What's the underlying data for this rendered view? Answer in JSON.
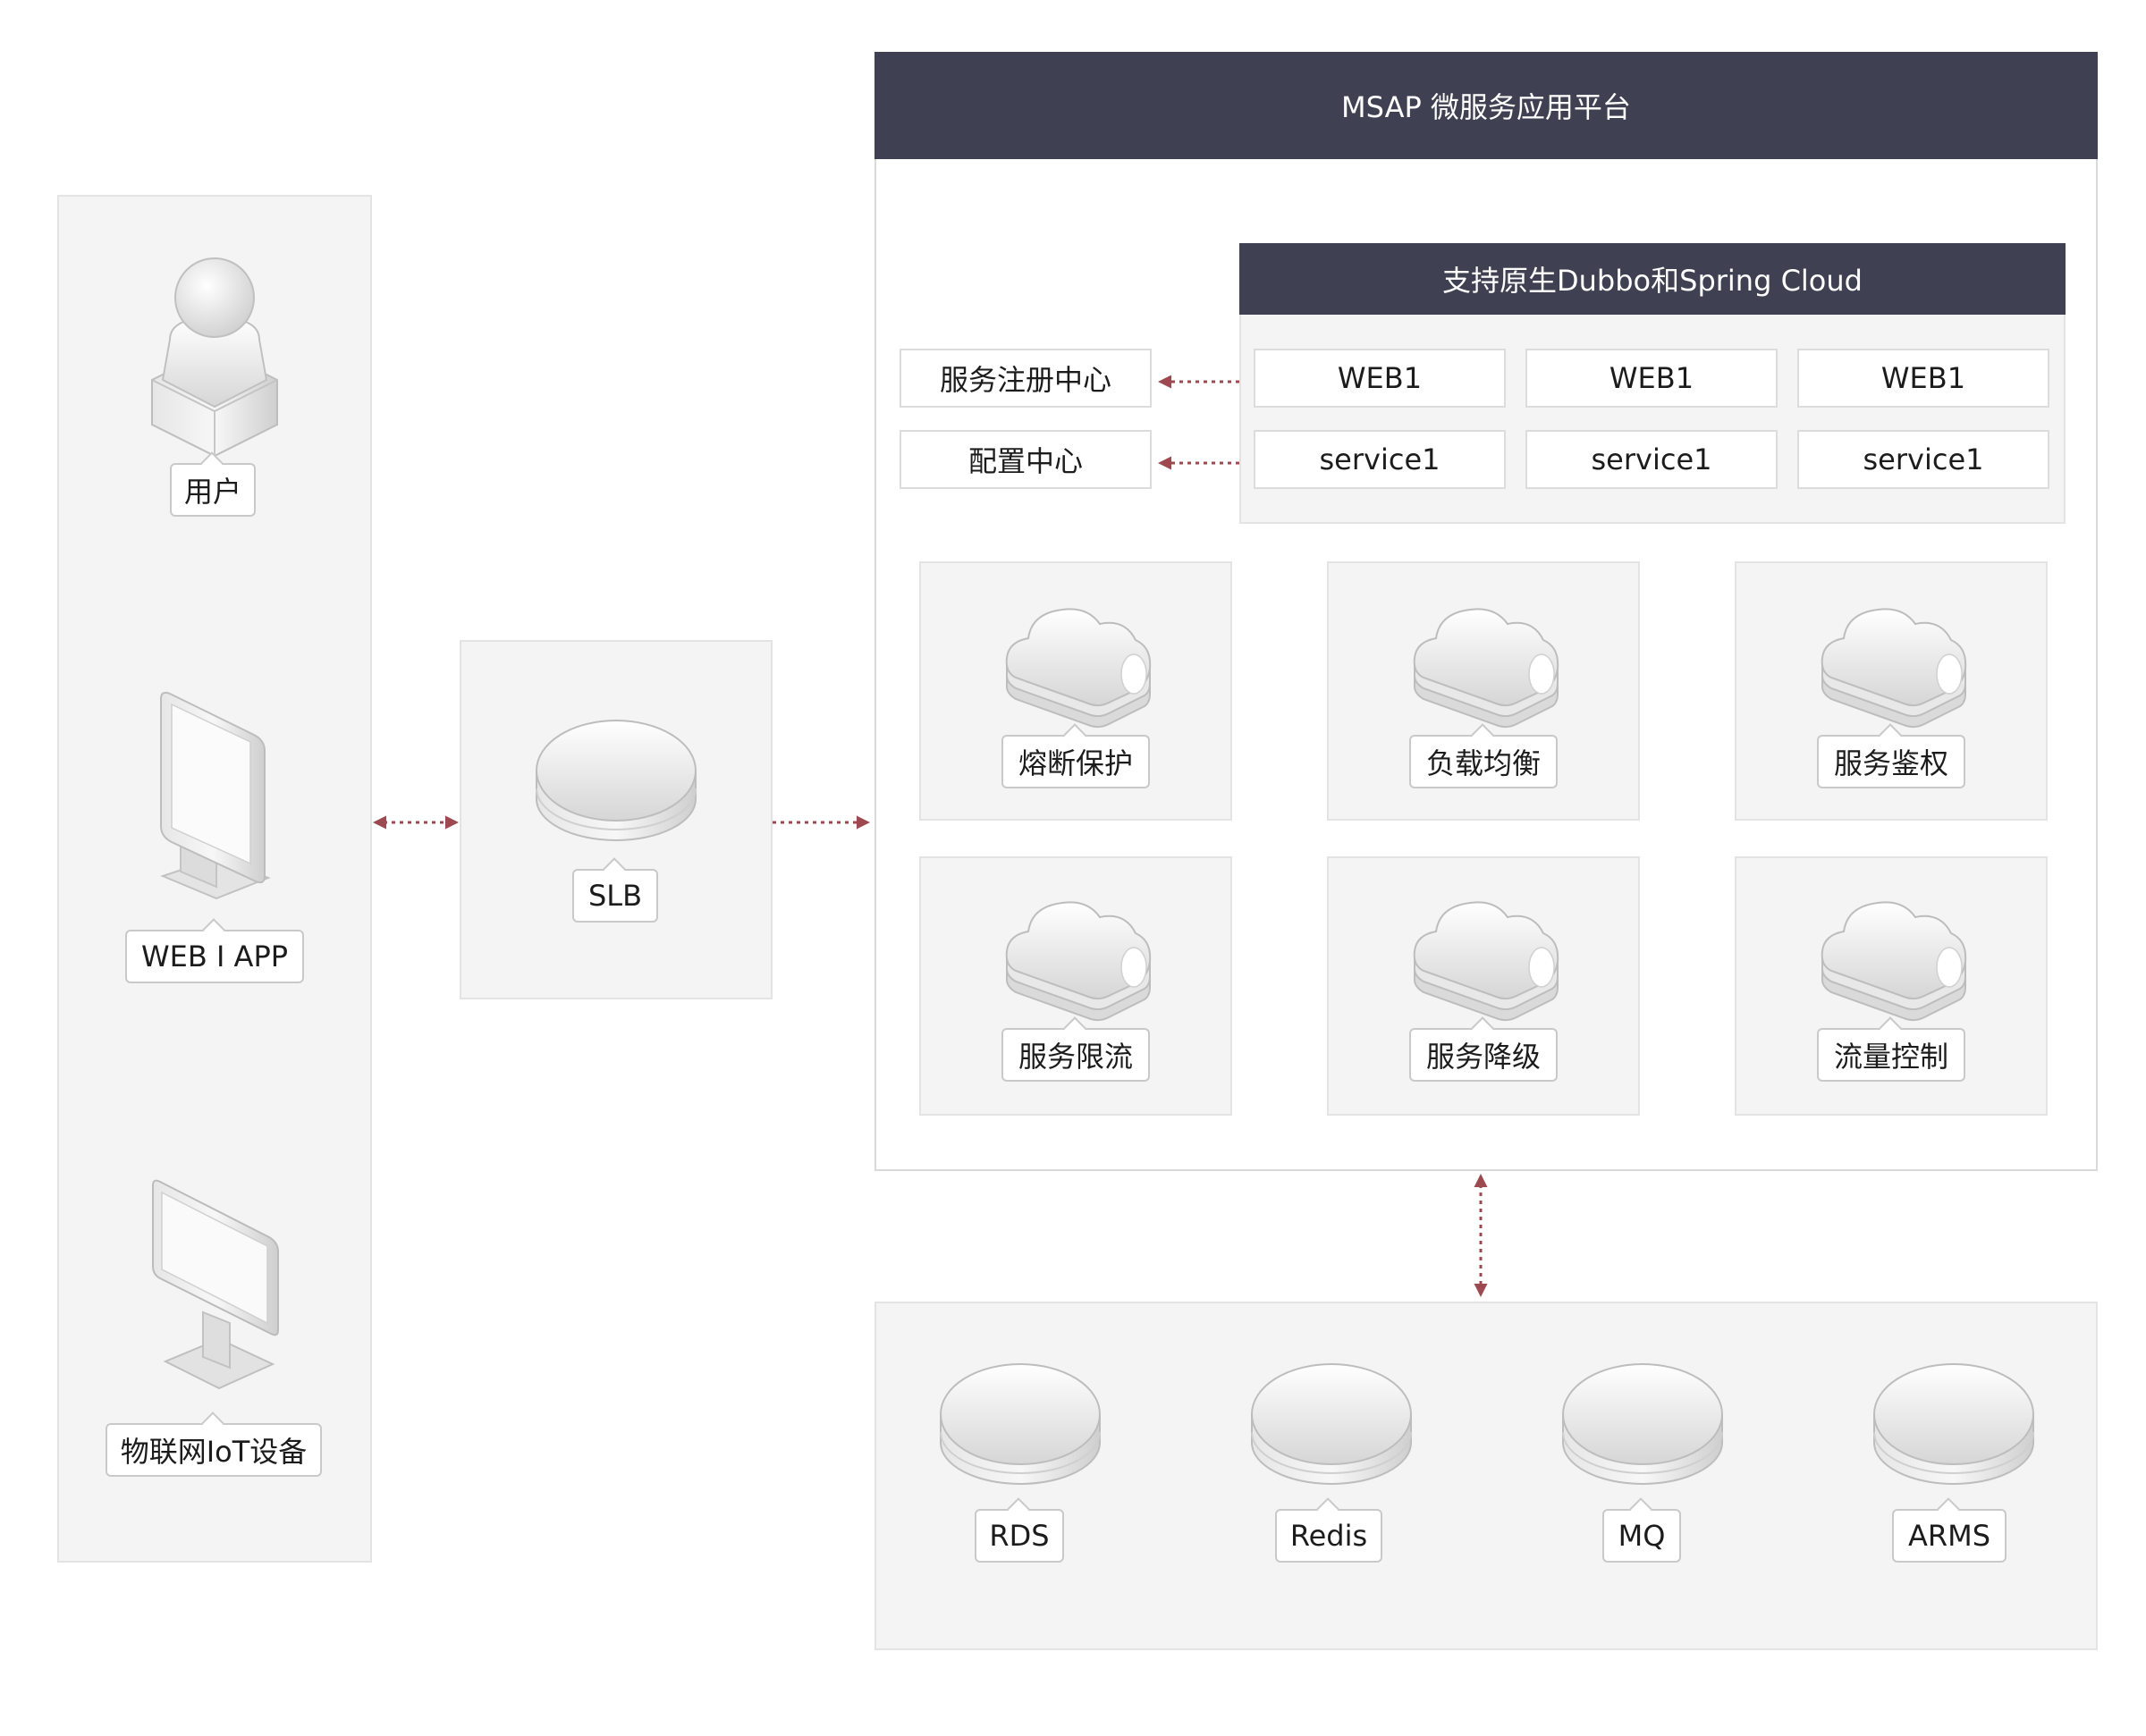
{
  "left_column": {
    "items": [
      {
        "label": "用户",
        "icon": "user-icon"
      },
      {
        "label": "WEB I APP",
        "icon": "tablet-icon"
      },
      {
        "label": "物联网IoT设备",
        "icon": "monitor-icon"
      }
    ]
  },
  "slb": {
    "label": "SLB",
    "icon": "load-balancer-icon"
  },
  "msap": {
    "title": "MSAP 微服务应用平台",
    "framework": {
      "title": "支持原生Dubbo和Spring Cloud",
      "web_row": [
        "WEB1",
        "WEB1",
        "WEB1"
      ],
      "service_row": [
        "service1",
        "service1",
        "service1"
      ]
    },
    "centers": [
      "服务注册中心",
      "配置中心"
    ],
    "capabilities": [
      "熔断保护",
      "负载均衡",
      "服务鉴权",
      "服务限流",
      "服务降级",
      "流量控制"
    ]
  },
  "backends": [
    "RDS",
    "Redis",
    "MQ",
    "ARMS"
  ],
  "colors": {
    "header": "#3f4051",
    "arrow": "#9c4a4f",
    "panel": "#f4f4f4"
  }
}
